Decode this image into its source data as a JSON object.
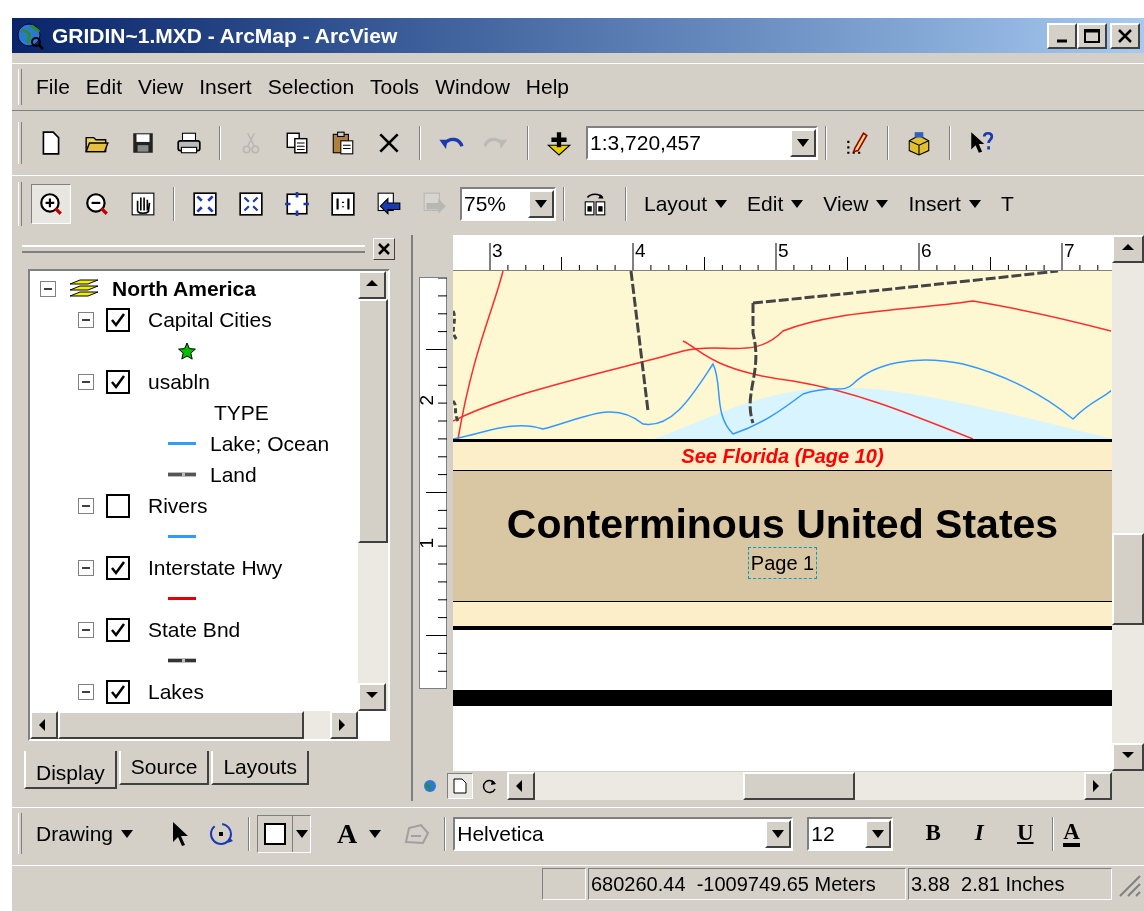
{
  "window": {
    "title": "GRIDIN~1.MXD - ArcMap - ArcView"
  },
  "menu": [
    "File",
    "Edit",
    "View",
    "Insert",
    "Selection",
    "Tools",
    "Window",
    "Help"
  ],
  "standard_toolbar": [
    {
      "kind": "new",
      "disabled": false
    },
    {
      "kind": "open",
      "disabled": false
    },
    {
      "kind": "save",
      "disabled": false
    },
    {
      "kind": "print",
      "disabled": false
    },
    {
      "kind": "separator"
    },
    {
      "kind": "cut",
      "disabled": true
    },
    {
      "kind": "copy",
      "disabled": false
    },
    {
      "kind": "paste",
      "disabled": false
    },
    {
      "kind": "delete",
      "disabled": false
    },
    {
      "kind": "separator"
    },
    {
      "kind": "undo",
      "disabled": false
    },
    {
      "kind": "redo",
      "disabled": true
    },
    {
      "kind": "separator"
    },
    {
      "kind": "add-data",
      "disabled": false
    },
    {
      "kind": "scale-combo",
      "value": "1:3,720,457"
    },
    {
      "kind": "separator"
    },
    {
      "kind": "editor",
      "disabled": false
    },
    {
      "kind": "separator"
    },
    {
      "kind": "toolbox",
      "disabled": false
    },
    {
      "kind": "separator"
    },
    {
      "kind": "whats-this",
      "disabled": false
    }
  ],
  "layout_toolbar": [
    {
      "kind": "zoom-in",
      "selected": true,
      "disabled": false
    },
    {
      "kind": "zoom-out",
      "selected": false,
      "disabled": false
    },
    {
      "kind": "pan",
      "selected": false,
      "disabled": false
    },
    {
      "kind": "separator"
    },
    {
      "kind": "full-extent",
      "selected": false,
      "disabled": false
    },
    {
      "kind": "fixed-zoom-in",
      "selected": false,
      "disabled": false
    },
    {
      "kind": "fixed-zoom-out",
      "selected": false,
      "disabled": false
    },
    {
      "kind": "zoom-100",
      "selected": false,
      "disabled": false
    },
    {
      "kind": "back",
      "selected": false,
      "disabled": false
    },
    {
      "kind": "forward",
      "selected": false,
      "disabled": true
    },
    {
      "kind": "zoom-combo",
      "value": "75%"
    },
    {
      "kind": "separator"
    },
    {
      "kind": "toggle",
      "selected": false,
      "disabled": false
    },
    {
      "kind": "separator"
    }
  ],
  "layout_menus": [
    {
      "label": "Layout",
      "dropdown": true
    },
    {
      "label": "Edit",
      "dropdown": true
    },
    {
      "label": "View",
      "dropdown": true
    },
    {
      "label": "Insert",
      "dropdown": true
    },
    {
      "label": "T",
      "dropdown": false
    }
  ],
  "toc": {
    "tree": [
      {
        "label": "North America",
        "expanded": true,
        "children": [
          {
            "label": "Capital Cities",
            "checked": true,
            "expanded": true,
            "legend": [
              {
                "kind": "marker",
                "color": "#00c000"
              }
            ]
          },
          {
            "label": "usabln",
            "checked": true,
            "expanded": true,
            "legend": [
              {
                "kind": "heading",
                "label": "TYPE"
              },
              {
                "kind": "line",
                "label": "Lake; Ocean",
                "color": "#3399ff"
              },
              {
                "kind": "dashed",
                "label": "Land",
                "color": "#555555"
              }
            ]
          },
          {
            "label": "Rivers",
            "checked": false,
            "expanded": true,
            "legend": [
              {
                "kind": "line",
                "color": "#3399ff"
              }
            ]
          },
          {
            "label": "Interstate Hwy",
            "checked": true,
            "expanded": true,
            "legend": [
              {
                "kind": "line",
                "color": "#e00000"
              }
            ]
          },
          {
            "label": "State Bnd",
            "checked": true,
            "expanded": true,
            "legend": [
              {
                "kind": "dashed",
                "color": "#333333"
              }
            ]
          },
          {
            "label": "Lakes",
            "checked": true,
            "expanded": true
          }
        ]
      }
    ],
    "tabs": [
      {
        "label": "Display",
        "selected": true
      },
      {
        "label": "Source",
        "selected": false
      },
      {
        "label": "Layouts",
        "selected": false
      }
    ]
  },
  "layout_page": {
    "top_ruler": [
      "3",
      "4",
      "5",
      "6",
      "7"
    ],
    "left_ruler": [
      "2",
      "1"
    ],
    "callout": "See Florida (Page 10)",
    "title": "Conterminous United States",
    "page_label": {
      "text": "Page 1",
      "selected": true
    }
  },
  "drawing_toolbar": {
    "menu": "Drawing",
    "text_tool": "A",
    "font": "Helvetica",
    "size": "12",
    "styles": [
      {
        "label": "B",
        "kind": "bold"
      },
      {
        "label": "I",
        "kind": "italic"
      },
      {
        "label": "U",
        "kind": "underline"
      }
    ],
    "font_color": "A"
  },
  "status_bar": [
    "680260.44  -1009749.65 Meters",
    "3.88  2.81 Inches"
  ]
}
